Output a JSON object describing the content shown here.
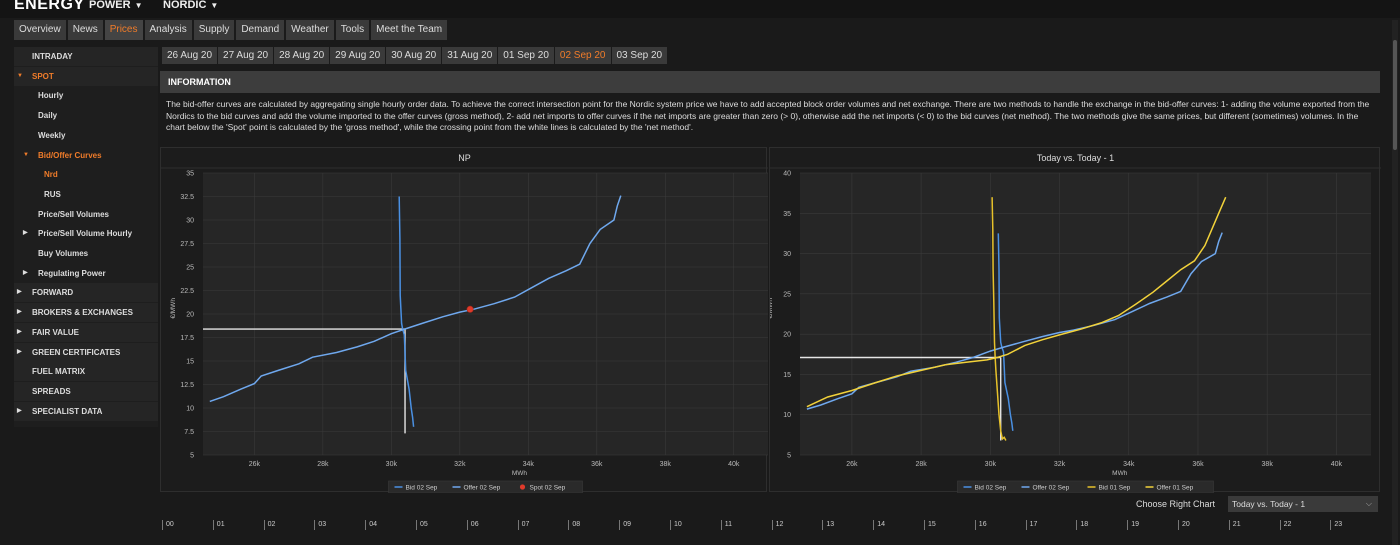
{
  "header": {
    "brand": "ENERGY",
    "menu": [
      {
        "label": "POWER"
      },
      {
        "label": "NORDIC"
      }
    ]
  },
  "nav_tabs": [
    "Overview",
    "News",
    "Prices",
    "Analysis",
    "Supply",
    "Demand",
    "Weather",
    "Tools",
    "Meet the Team"
  ],
  "nav_active": "Prices",
  "sidebar": {
    "items": [
      {
        "label": "INTRADAY",
        "level": 0,
        "arrow": "",
        "active": false
      },
      {
        "label": "SPOT",
        "level": 0,
        "arrow": "▼",
        "active": true
      },
      {
        "label": "Hourly",
        "level": 1,
        "arrow": "",
        "active": false
      },
      {
        "label": "Daily",
        "level": 1,
        "arrow": "",
        "active": false
      },
      {
        "label": "Weekly",
        "level": 1,
        "arrow": "",
        "active": false
      },
      {
        "label": "Bid/Offer Curves",
        "level": 1,
        "arrow": "▼",
        "active": true
      },
      {
        "label": "Nrd",
        "level": 2,
        "arrow": "",
        "active": true
      },
      {
        "label": "RUS",
        "level": 2,
        "arrow": "",
        "active": false
      },
      {
        "label": "Price/Sell Volumes",
        "level": 1,
        "arrow": "",
        "active": false
      },
      {
        "label": "Price/Sell Volume Hourly",
        "level": 1,
        "arrow": "▶",
        "active": false
      },
      {
        "label": "Buy Volumes",
        "level": 1,
        "arrow": "",
        "active": false
      },
      {
        "label": "Regulating Power",
        "level": 1,
        "arrow": "▶",
        "active": false
      },
      {
        "label": "FORWARD",
        "level": 0,
        "arrow": "▶",
        "active": false
      },
      {
        "label": "BROKERS & EXCHANGES",
        "level": 0,
        "arrow": "▶",
        "active": false
      },
      {
        "label": "FAIR VALUE",
        "level": 0,
        "arrow": "▶",
        "active": false
      },
      {
        "label": "GREEN CERTIFICATES",
        "level": 0,
        "arrow": "▶",
        "active": false
      },
      {
        "label": "FUEL MATRIX",
        "level": 0,
        "arrow": "",
        "active": false
      },
      {
        "label": "SPREADS",
        "level": 0,
        "arrow": "",
        "active": false
      },
      {
        "label": "SPECIALIST DATA",
        "level": 0,
        "arrow": "▶",
        "active": false
      }
    ]
  },
  "date_tabs": [
    "26 Aug 20",
    "27 Aug 20",
    "28 Aug 20",
    "29 Aug 20",
    "30 Aug 20",
    "31 Aug 20",
    "01 Sep 20",
    "02 Sep 20",
    "03 Sep 20"
  ],
  "date_active": "02 Sep 20",
  "info": {
    "title": "INFORMATION",
    "text": "The bid-offer curves are calculated by aggregating single hourly order data. To achieve the correct intersection point for the Nordic system price we have to add accepted block order volumes and net exchange. There are two methods to handle the exchange in the bid-offer curves: 1- adding the volume exported from the Nordics to the bid curves and add the volume imported to the offer curves (gross method), 2- add net imports to offer curves if the net imports are greater than zero (> 0), otherwise add the net imports (< 0) to the bid curves (net method). The two methods give the same prices, but different (sometimes) volumes. In the chart below the 'Spot' point is calculated by the 'gross method', while the crossing point from the white lines is calculated by the 'net method'."
  },
  "colors": {
    "bid": "#4a90e2",
    "offer": "#6fa8ee",
    "bid_prev": "#e8c22a",
    "offer_prev": "#f2d23a",
    "spot": "#e03a2a",
    "cross": "#e6e6e6",
    "accent": "#f07c2a"
  },
  "chart_data": [
    {
      "type": "line",
      "title": "NP",
      "xlabel": "MWh",
      "ylabel": "€/MWh",
      "xlim": [
        24500,
        41000
      ],
      "ylim": [
        5,
        35
      ],
      "x_ticks": [
        26000,
        28000,
        30000,
        32000,
        34000,
        36000,
        38000,
        40000
      ],
      "x_tick_labels": [
        "26k",
        "28k",
        "30k",
        "32k",
        "34k",
        "36k",
        "38k",
        "40k"
      ],
      "y_ticks": [
        5,
        7.5,
        10,
        12.5,
        15,
        17.5,
        20,
        22.5,
        25,
        27.5,
        30,
        32.5,
        35
      ],
      "y_tick_labels": [
        "5",
        "7.5",
        "10",
        "12.5",
        "15",
        "17.5",
        "20",
        "22.5",
        "25",
        "27.5",
        "30",
        "32.5",
        "35"
      ],
      "grid": true,
      "legend_position": "bottom",
      "series": [
        {
          "name": "Bid 02 Sep",
          "color_key": "bid",
          "points": [
            [
              30230,
              32.5
            ],
            [
              30250,
              28
            ],
            [
              30260,
              22
            ],
            [
              30280,
              20.5
            ],
            [
              30300,
              19
            ],
            [
              30330,
              18.4
            ],
            [
              30380,
              17.8
            ],
            [
              30400,
              16
            ],
            [
              30420,
              14
            ],
            [
              30520,
              12
            ],
            [
              30580,
              10
            ],
            [
              30620,
              9
            ],
            [
              30650,
              8
            ]
          ]
        },
        {
          "name": "Offer 02 Sep",
          "color_key": "offer",
          "points": [
            [
              24700,
              10.7
            ],
            [
              25100,
              11.2
            ],
            [
              25600,
              12.0
            ],
            [
              26000,
              12.6
            ],
            [
              26200,
              13.4
            ],
            [
              26700,
              14.0
            ],
            [
              27300,
              14.7
            ],
            [
              27700,
              15.4
            ],
            [
              28400,
              15.9
            ],
            [
              29000,
              16.5
            ],
            [
              29500,
              17.1
            ],
            [
              30000,
              17.9
            ],
            [
              30400,
              18.4
            ],
            [
              30900,
              19.0
            ],
            [
              31500,
              19.7
            ],
            [
              32000,
              20.2
            ],
            [
              32400,
              20.5
            ],
            [
              33000,
              21.1
            ],
            [
              33600,
              21.8
            ],
            [
              34100,
              22.8
            ],
            [
              34600,
              23.8
            ],
            [
              35100,
              24.6
            ],
            [
              35500,
              25.3
            ],
            [
              35800,
              27.5
            ],
            [
              36100,
              29.0
            ],
            [
              36500,
              30.0
            ],
            [
              36600,
              31.5
            ],
            [
              36700,
              32.6
            ]
          ]
        },
        {
          "name": "Spot 02 Sep",
          "color_key": "spot",
          "marker": true,
          "points": [
            [
              32300,
              20.5
            ]
          ]
        }
      ],
      "cross_lines": {
        "h": {
          "y": 18.4,
          "x_from": 24500,
          "x_to": 30400
        },
        "v": {
          "x": 30400,
          "y_from": 7.3,
          "y_to": 18.4
        }
      }
    },
    {
      "type": "line",
      "title": "Today vs. Today - 1",
      "xlabel": "MWh",
      "ylabel": "€/MWh",
      "xlim": [
        24500,
        41000
      ],
      "ylim": [
        5,
        40
      ],
      "x_ticks": [
        26000,
        28000,
        30000,
        32000,
        34000,
        36000,
        38000,
        40000
      ],
      "x_tick_labels": [
        "26k",
        "28k",
        "30k",
        "32k",
        "34k",
        "36k",
        "38k",
        "40k"
      ],
      "y_ticks": [
        5,
        10,
        15,
        20,
        25,
        30,
        35,
        40
      ],
      "y_tick_labels": [
        "5",
        "10",
        "15",
        "20",
        "25",
        "30",
        "35",
        "40"
      ],
      "grid": true,
      "legend_position": "bottom",
      "series": [
        {
          "name": "Bid 02 Sep",
          "color_key": "bid",
          "points": [
            [
              30230,
              32.5
            ],
            [
              30250,
              28
            ],
            [
              30260,
              22
            ],
            [
              30280,
              20.5
            ],
            [
              30300,
              19
            ],
            [
              30330,
              18.4
            ],
            [
              30380,
              17.8
            ],
            [
              30400,
              16
            ],
            [
              30420,
              14
            ],
            [
              30520,
              12
            ],
            [
              30580,
              10
            ],
            [
              30620,
              9
            ],
            [
              30650,
              8
            ]
          ]
        },
        {
          "name": "Offer 02 Sep",
          "color_key": "offer",
          "points": [
            [
              24700,
              10.7
            ],
            [
              25100,
              11.2
            ],
            [
              25600,
              12.0
            ],
            [
              26000,
              12.6
            ],
            [
              26200,
              13.4
            ],
            [
              26700,
              14.0
            ],
            [
              27300,
              14.7
            ],
            [
              27700,
              15.4
            ],
            [
              28400,
              15.9
            ],
            [
              29000,
              16.5
            ],
            [
              29500,
              17.1
            ],
            [
              30000,
              17.9
            ],
            [
              30400,
              18.4
            ],
            [
              30900,
              19.0
            ],
            [
              31500,
              19.7
            ],
            [
              32000,
              20.2
            ],
            [
              32400,
              20.5
            ],
            [
              33000,
              21.1
            ],
            [
              33600,
              21.8
            ],
            [
              34100,
              22.8
            ],
            [
              34600,
              23.8
            ],
            [
              35100,
              24.6
            ],
            [
              35500,
              25.3
            ],
            [
              35800,
              27.5
            ],
            [
              36100,
              29.0
            ],
            [
              36500,
              30.0
            ],
            [
              36600,
              31.5
            ],
            [
              36700,
              32.6
            ]
          ]
        },
        {
          "name": "Bid 01 Sep",
          "color_key": "bid_prev",
          "points": [
            [
              30050,
              37
            ],
            [
              30070,
              33
            ],
            [
              30080,
              28
            ],
            [
              30100,
              24
            ],
            [
              30120,
              19
            ],
            [
              30140,
              17
            ],
            [
              30160,
              15.5
            ],
            [
              30200,
              13
            ],
            [
              30250,
              10
            ],
            [
              30300,
              8
            ],
            [
              30350,
              7
            ],
            [
              30400,
              7.2
            ],
            [
              30450,
              6.8
            ]
          ]
        },
        {
          "name": "Offer 01 Sep",
          "color_key": "offer_prev",
          "points": [
            [
              24700,
              11.0
            ],
            [
              25300,
              12.2
            ],
            [
              26000,
              13.0
            ],
            [
              26700,
              14.0
            ],
            [
              27300,
              14.8
            ],
            [
              28000,
              15.5
            ],
            [
              28700,
              16.2
            ],
            [
              29300,
              16.5
            ],
            [
              29900,
              16.8
            ],
            [
              30200,
              17.1
            ],
            [
              30500,
              17.5
            ],
            [
              31000,
              18.6
            ],
            [
              31500,
              19.3
            ],
            [
              32000,
              19.9
            ],
            [
              32600,
              20.6
            ],
            [
              33200,
              21.4
            ],
            [
              33700,
              22.3
            ],
            [
              34200,
              23.7
            ],
            [
              34700,
              25.2
            ],
            [
              35100,
              26.6
            ],
            [
              35500,
              28.0
            ],
            [
              35900,
              29.1
            ],
            [
              36200,
              31.0
            ],
            [
              36400,
              33.0
            ],
            [
              36600,
              35.0
            ],
            [
              36800,
              37.0
            ]
          ]
        }
      ],
      "cross_lines": {
        "h": {
          "y": 17.1,
          "x_from": 24500,
          "x_to": 30300
        },
        "v": {
          "x": 30300,
          "y_from": 6.8,
          "y_to": 17.1
        }
      }
    }
  ],
  "chooser": {
    "label": "Choose Right Chart",
    "value": "Today vs. Today - 1"
  },
  "hours": [
    "00",
    "01",
    "02",
    "03",
    "04",
    "05",
    "06",
    "07",
    "08",
    "09",
    "10",
    "11",
    "12",
    "13",
    "14",
    "15",
    "16",
    "17",
    "18",
    "19",
    "20",
    "21",
    "22",
    "23"
  ]
}
